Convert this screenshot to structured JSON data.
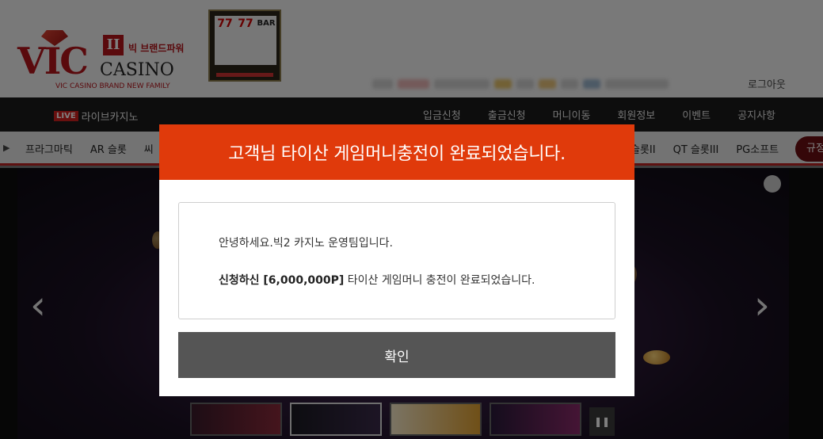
{
  "header": {
    "logo": {
      "brand_text": "VIC",
      "casino_text": "CASINO",
      "badge": "II",
      "tagline": "빅 브랜드파워",
      "subtitle": "VIC CASINO BRAND NEW FAMILY"
    },
    "slot_reels": [
      "77",
      "77",
      "BAR"
    ],
    "logout_label": "로그아웃"
  },
  "main_nav": {
    "live_badge": "LIVE",
    "live_label": "라이브카지노",
    "items": [
      "입금신청",
      "출금신청",
      "머니이동",
      "회원정보",
      "이벤트",
      "공지사항"
    ]
  },
  "sub_nav": {
    "left_items": [
      "프라그마틱",
      "AR 슬롯",
      "씨"
    ],
    "right_items": [
      "슬롯II",
      "QT 슬롯III",
      "PG소프트"
    ],
    "button_label": "규정"
  },
  "modal": {
    "title": "고객님 타이산 게임머니충전이 완료되었습니다.",
    "greeting": "안녕하세요.빅2 카지노 운영팀입니다.",
    "request_prefix": "신청하신 [6,000,000P]",
    "request_suffix": " 타이산 게임머니 충전이 완료되었습니다.",
    "confirm_label": "확인"
  },
  "slider": {
    "prev_icon": "‹",
    "next_icon": "›",
    "pause_icon": "❚❚"
  },
  "colors": {
    "modal_header": "#e03a0b",
    "confirm_button": "#555555",
    "nav_background": "#1b1b1b",
    "accent_red": "#b4141b"
  }
}
